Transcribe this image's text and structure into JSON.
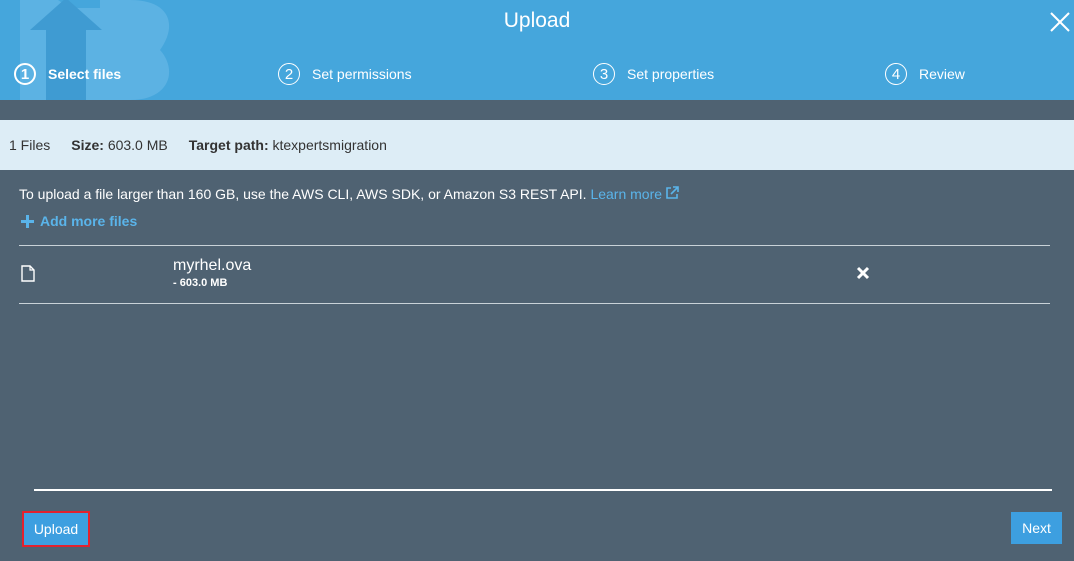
{
  "dialog": {
    "title": "Upload"
  },
  "steps": [
    {
      "number": "1",
      "label": "Select files",
      "active": true
    },
    {
      "number": "2",
      "label": "Set permissions",
      "active": false
    },
    {
      "number": "3",
      "label": "Set properties",
      "active": false
    },
    {
      "number": "4",
      "label": "Review",
      "active": false
    }
  ],
  "info": {
    "files_count": "1 Files",
    "size_label": "Size:",
    "size_value": "603.0 MB",
    "target_label": "Target path:",
    "target_value": "ktexpertsmigration"
  },
  "notice": {
    "text": "To upload a file larger than 160 GB, use the AWS CLI, AWS SDK, or Amazon S3 REST API.",
    "link_label": "Learn more"
  },
  "add_files": {
    "label": "Add more files"
  },
  "files": [
    {
      "name": "myrhel.ova",
      "size": "- 603.0 MB"
    }
  ],
  "buttons": {
    "upload_label": "Upload",
    "next_label": "Next"
  },
  "colors": {
    "header_bg": "#45a6dc",
    "body_bg": "#4f6272",
    "info_bg": "#ddedf6",
    "link": "#5ab4ea",
    "button_bg": "#3d9fe0",
    "highlight": "#e3212e"
  },
  "icons": {
    "close": "close-icon",
    "external_link": "external-link-icon",
    "add": "plus-icon",
    "file": "file-icon",
    "remove": "remove-icon"
  }
}
